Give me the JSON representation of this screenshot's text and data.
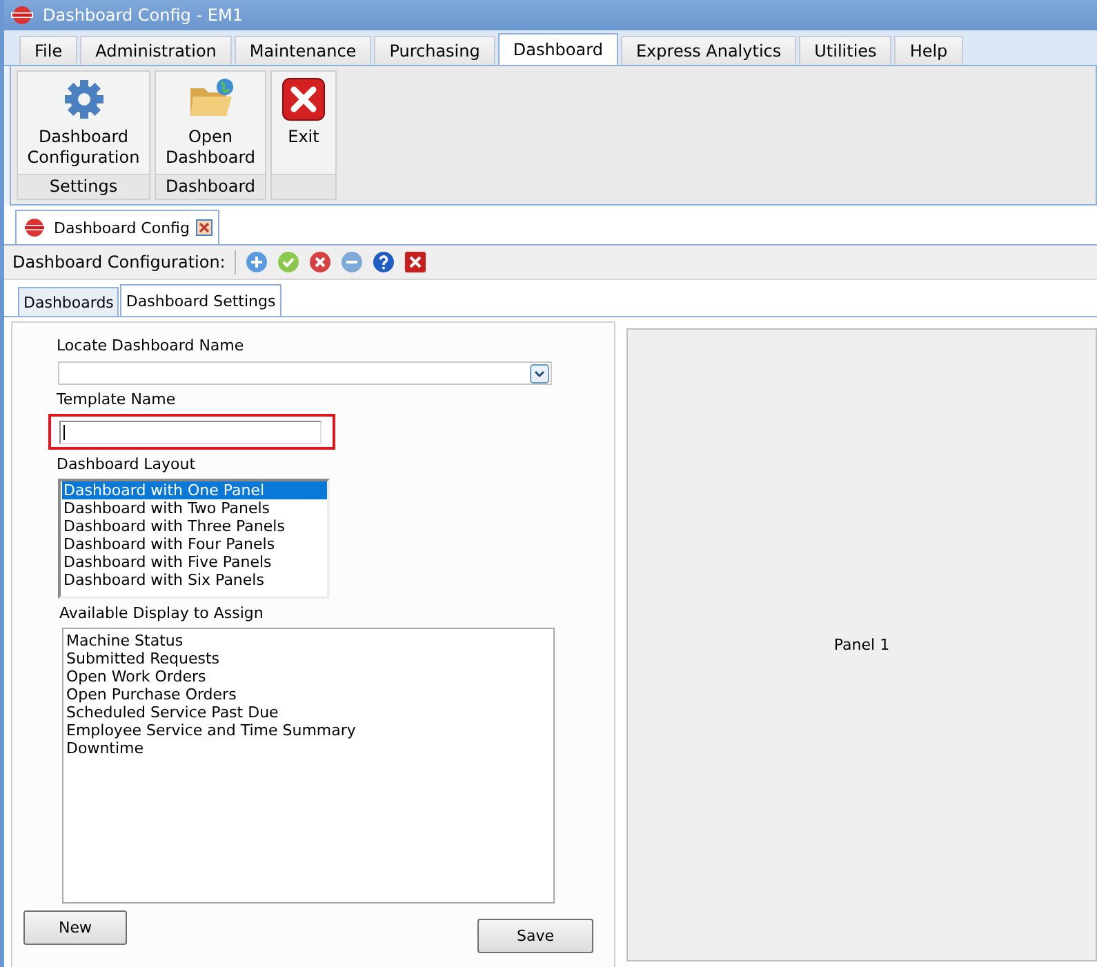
{
  "window": {
    "title": "Dashboard Config - EM1"
  },
  "menu_tabs": [
    {
      "label": "File",
      "selected": false
    },
    {
      "label": "Administration",
      "selected": false
    },
    {
      "label": "Maintenance",
      "selected": false
    },
    {
      "label": "Purchasing",
      "selected": false
    },
    {
      "label": "Dashboard",
      "selected": true
    },
    {
      "label": "Express Analytics",
      "selected": false
    },
    {
      "label": "Utilities",
      "selected": false
    },
    {
      "label": "Help",
      "selected": false
    }
  ],
  "ribbon": [
    {
      "label": "Dashboard Configuration",
      "kind": "gear",
      "group": "Settings"
    },
    {
      "label": "Open Dashboard",
      "kind": "folder",
      "group": "Dashboard"
    },
    {
      "label": "Exit",
      "kind": "exit"
    }
  ],
  "document_tab": {
    "label": "Dashboard Config"
  },
  "toolbar": {
    "label": "Dashboard Configuration:",
    "buttons": [
      {
        "kind": "add"
      },
      {
        "kind": "ok"
      },
      {
        "kind": "cancel"
      },
      {
        "kind": "remove"
      },
      {
        "kind": "help"
      },
      {
        "kind": "close"
      }
    ]
  },
  "sub_tabs": [
    {
      "label": "Dashboards",
      "selected": false
    },
    {
      "label": "Dashboard Settings",
      "selected": true
    }
  ],
  "form": {
    "locate_label": "Locate Dashboard Name",
    "template_label": "Template Name",
    "template_focused": true,
    "layout_label": "Dashboard Layout",
    "layouts": [
      {
        "label": "Dashboard with One Panel",
        "selected": true
      },
      {
        "label": "Dashboard with Two Panels",
        "selected": false
      },
      {
        "label": "Dashboard with Three Panels",
        "selected": false
      },
      {
        "label": "Dashboard with Four Panels",
        "selected": false
      },
      {
        "label": "Dashboard with Five Panels",
        "selected": false
      },
      {
        "label": "Dashboard with Six Panels",
        "selected": false
      }
    ],
    "available_label": "Available Display to Assign",
    "available": [
      "Machine Status",
      "Submitted Requests",
      "Open Work Orders",
      "Open Purchase Orders",
      "Scheduled Service Past Due",
      "Employee Service and Time Summary",
      "Downtime"
    ],
    "new_button": "New",
    "save_button": "Save"
  },
  "preview": {
    "label": "Panel 1"
  }
}
